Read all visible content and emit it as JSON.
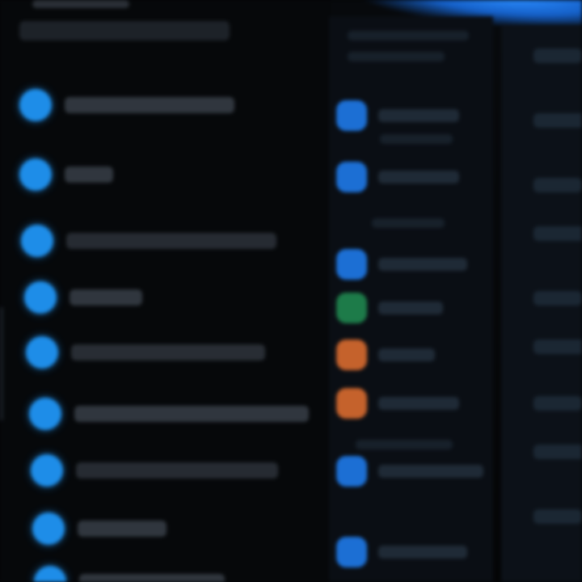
{
  "window": {
    "title": "",
    "subtitle": ""
  },
  "colors": {
    "accent_blue": "#1e8de8",
    "mid_blue": "#1c6fd4",
    "green": "#1d7b49",
    "orange": "#c5622c",
    "background": "#050608"
  },
  "left_list": {
    "items": [
      {
        "label": "",
        "icon": "app-icon"
      },
      {
        "label": "",
        "icon": "app-icon"
      },
      {
        "label": "",
        "icon": "app-icon"
      },
      {
        "label": "",
        "icon": "app-icon"
      },
      {
        "label": "",
        "icon": "app-icon"
      },
      {
        "label": "",
        "icon": "app-icon"
      },
      {
        "label": "",
        "icon": "app-icon"
      },
      {
        "label": "",
        "icon": "app-icon"
      },
      {
        "label": "",
        "icon": "app-icon"
      }
    ]
  },
  "mid_list": {
    "items": [
      {
        "label": "",
        "icon": "app-icon",
        "color": "blue"
      },
      {
        "label": "",
        "icon": "app-icon",
        "color": "blue"
      },
      {
        "label": "",
        "icon": "app-icon",
        "color": "blue"
      },
      {
        "label": "",
        "icon": "app-icon",
        "color": "green"
      },
      {
        "label": "",
        "icon": "app-icon",
        "color": "orange"
      },
      {
        "label": "",
        "icon": "app-icon",
        "color": "orange"
      },
      {
        "label": "",
        "icon": "app-icon",
        "color": "blue"
      },
      {
        "label": "",
        "icon": "app-icon",
        "color": "blue"
      }
    ]
  }
}
